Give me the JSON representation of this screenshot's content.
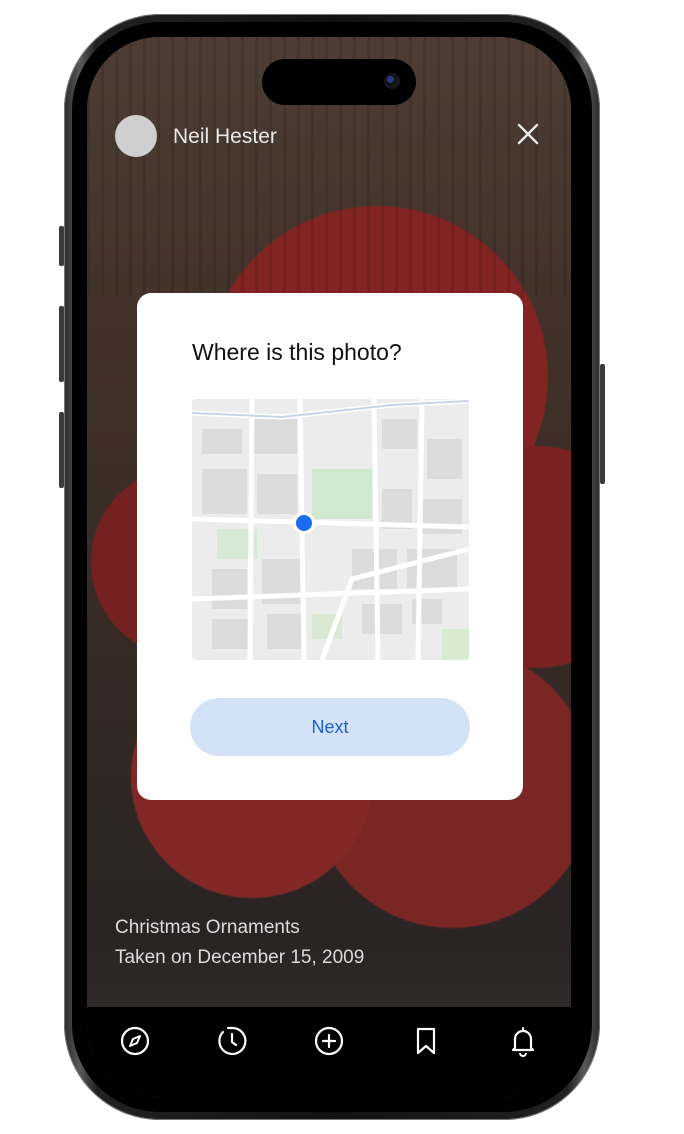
{
  "header": {
    "user_name": "Neil Hester",
    "close_icon": "close-icon"
  },
  "modal": {
    "title": "Where is this photo?",
    "next_label": "Next"
  },
  "photo": {
    "title": "Christmas Ornaments",
    "taken_on": "Taken on December 15, 2009"
  },
  "tabbar": {
    "items": [
      "compass-icon",
      "history-icon",
      "add-icon",
      "bookmark-icon",
      "bell-icon"
    ]
  },
  "colors": {
    "accent": "#1f5fc9",
    "button_bg": "#d3e2f7",
    "location_dot": "#1a6cf0"
  }
}
